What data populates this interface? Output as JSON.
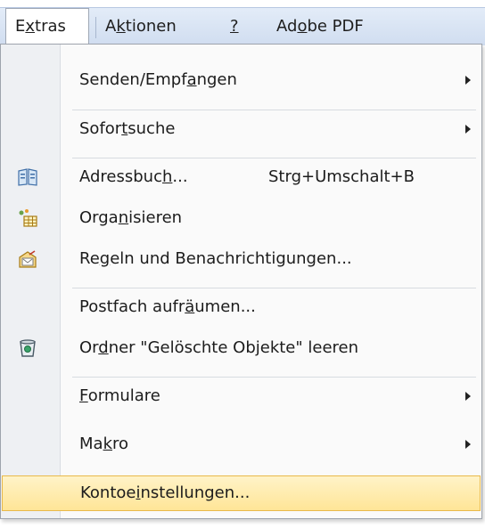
{
  "menubar": {
    "items": [
      {
        "pre": "E",
        "ul": "x",
        "post": "tras",
        "active": true
      },
      {
        "pre": "A",
        "ul": "k",
        "post": "tionen"
      },
      {
        "pre": "",
        "ul": "?",
        "post": ""
      },
      {
        "pre": "Ad",
        "ul": "o",
        "post": "be PDF"
      }
    ]
  },
  "menu": {
    "items": [
      {
        "pre": "Senden/Empf",
        "ul": "a",
        "post": "ngen",
        "submenu": true
      },
      {
        "pre": "Sofor",
        "ul": "t",
        "post": "suche",
        "submenu": true
      },
      {
        "pre": "Adressbuc",
        "ul": "h",
        "post": "...",
        "shortcut": "Strg+Umschalt+B",
        "icon": "address-book-icon"
      },
      {
        "pre": "Orga",
        "ul": "n",
        "post": "isieren",
        "icon": "organize-icon"
      },
      {
        "pre": "Re",
        "ul": "g",
        "post": "eln und Benachrichtigungen...",
        "icon": "rules-icon"
      },
      {
        "pre": "Postfach aufr",
        "ul": "ä",
        "post": "umen..."
      },
      {
        "pre": "Or",
        "ul": "d",
        "post": "ner \"Gelöschte Objekte\" leeren",
        "icon": "empty-trash-icon"
      },
      {
        "pre": "",
        "ul": "F",
        "post": "ormulare",
        "submenu": true
      },
      {
        "pre": "Ma",
        "ul": "k",
        "post": "ro",
        "submenu": true
      },
      {
        "pre": "Kontoe",
        "ul": "i",
        "post": "nstellungen...",
        "highlighted": true
      }
    ]
  },
  "colors": {
    "highlight": "#ffe597",
    "menubar": "#d6e2f3"
  }
}
